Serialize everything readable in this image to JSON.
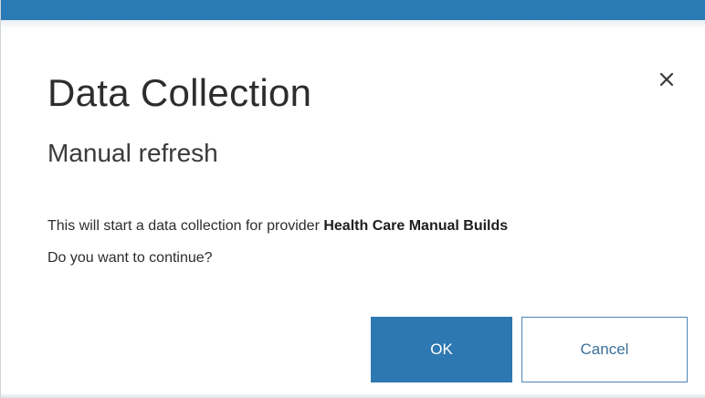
{
  "dialog": {
    "title": "Data Collection",
    "subtitle": "Manual refresh",
    "message_prefix": "This will start a data collection for provider ",
    "provider_name": "Health Care Manual Builds",
    "message_question": "Do you want to continue?",
    "close_icon": "close-icon"
  },
  "buttons": {
    "ok_label": "OK",
    "cancel_label": "Cancel"
  },
  "colors": {
    "accent": "#2a7ab5",
    "primary_button": "#2d78b0",
    "secondary_button_border": "#4e86b8"
  }
}
